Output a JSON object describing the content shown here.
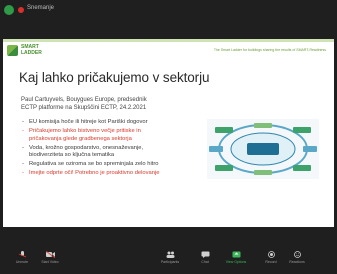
{
  "recording": {
    "label": "Snemanje"
  },
  "slide": {
    "logo_line1": "SMART",
    "logo_line2": "LADDER",
    "tagline": "The Smart Ladder for buildings sharing the results of SMART-Readiness",
    "title": "Kaj lahko pričakujemo v sektorju",
    "speaker_line1": "Paul Cartuyvels, Bouygues Europe, predsednik",
    "speaker_line2": "ECTP platforme na Skupščini ECTP, 24.2.2021",
    "bullets": [
      {
        "text": "EU komisija hoče ili hitreje kot Pariški dogovor",
        "color": "black"
      },
      {
        "text": "Pričakujemo lahko bistveno večje pritiske in pričakovanja glede gradbenega sektorja",
        "color": "red"
      },
      {
        "text": "Voda, krožno gospodarstvo, onesnaževanje, biodiverziteta so ključna tematika",
        "color": "black"
      },
      {
        "text": "Regulativa se oziroma se bo spreminjala zelo hitro",
        "color": "black"
      },
      {
        "text": "Imejte odprte oči! Potrebno je proaktivno delovanje",
        "color": "red"
      }
    ]
  },
  "controls": [
    {
      "label": "Unmute",
      "icon": "mic-icon"
    },
    {
      "label": "Start Video",
      "icon": "video-icon"
    },
    {
      "label": "Participants",
      "icon": "participants-icon"
    },
    {
      "label": "Chat",
      "icon": "chat-icon"
    },
    {
      "label": "View Options",
      "icon": "share-icon",
      "color": "#3bb75a"
    },
    {
      "label": "Record",
      "icon": "record-icon"
    },
    {
      "label": "Reactions",
      "icon": "reactions-icon"
    }
  ]
}
